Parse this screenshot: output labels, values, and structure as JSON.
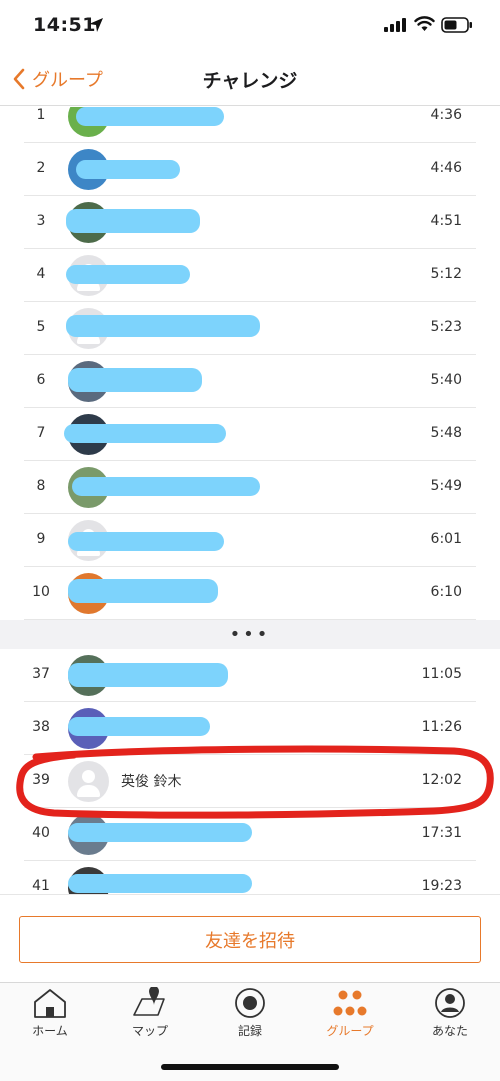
{
  "status_bar": {
    "time": "14:51"
  },
  "nav": {
    "back_label": "グループ",
    "title": "チャレンジ"
  },
  "accent_color": "#e7792b",
  "redaction_color": "#7dd3fc",
  "leaderboard": {
    "top": [
      {
        "rank": "1",
        "time": "4:36"
      },
      {
        "rank": "2",
        "time": "4:46"
      },
      {
        "rank": "3",
        "time": "4:51"
      },
      {
        "rank": "4",
        "time": "5:12"
      },
      {
        "rank": "5",
        "time": "5:23"
      },
      {
        "rank": "6",
        "time": "5:40"
      },
      {
        "rank": "7",
        "time": "5:48"
      },
      {
        "rank": "8",
        "time": "5:49"
      },
      {
        "rank": "9",
        "time": "6:01"
      },
      {
        "rank": "10",
        "time": "6:10"
      }
    ],
    "gap_indicator": "•••",
    "bottom": [
      {
        "rank": "37",
        "time": "11:05"
      },
      {
        "rank": "38",
        "time": "11:26"
      },
      {
        "rank": "39",
        "name": "英俊 鈴木",
        "time": "12:02"
      },
      {
        "rank": "40",
        "time": "17:31"
      },
      {
        "rank": "41",
        "time": "19:23"
      }
    ]
  },
  "invite_button": {
    "label": "友達を招待"
  },
  "tabs": [
    {
      "label": "ホーム",
      "icon": "home-icon"
    },
    {
      "label": "マップ",
      "icon": "map-icon"
    },
    {
      "label": "記録",
      "icon": "record-icon"
    },
    {
      "label": "グループ",
      "icon": "group-icon",
      "active": true
    },
    {
      "label": "あなた",
      "icon": "profile-icon"
    }
  ]
}
